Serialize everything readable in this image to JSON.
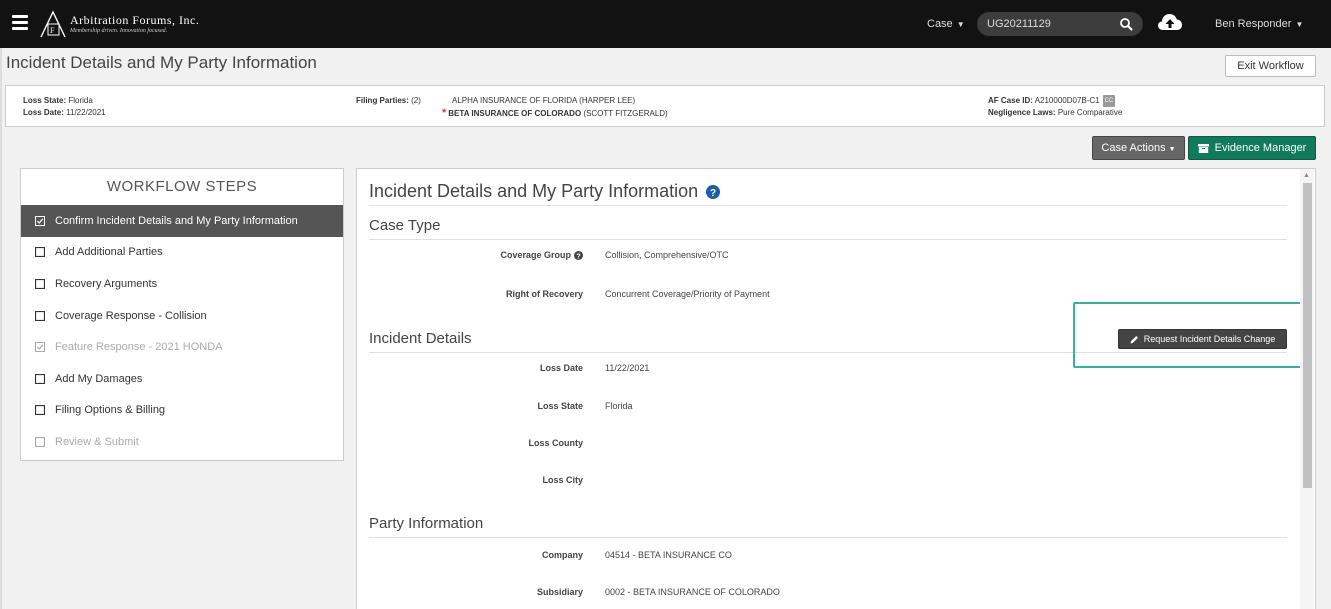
{
  "app": {
    "logo_name": "Arbitration Forums, Inc.",
    "logo_tagline": "Membership driven. Innovation focused.",
    "case_dropdown_label": "Case",
    "search_value": "UG20211129",
    "user_name": "Ben Responder"
  },
  "page": {
    "title": "Incident Details and My Party Information",
    "exit_label": "Exit Workflow"
  },
  "info_bar": {
    "loss_state_label": "Loss State:",
    "loss_state_value": "Florida",
    "loss_date_label": "Loss Date:",
    "loss_date_value": "11/22/2021",
    "filing_parties_label": "Filing Parties:",
    "filing_parties_count": "(2)",
    "parties": [
      {
        "name": "ALPHA INSURANCE OF FLORIDA",
        "contact": "(HARPER LEE)"
      },
      {
        "name": "BETA INSURANCE OF COLORADO",
        "contact": "(SCOTT FITZGERALD)",
        "marker": "*"
      }
    ],
    "case_id_label": "AF Case ID:",
    "case_id_value": "A210000D07B-C1",
    "cc_badge": "CC",
    "negligence_label": "Negligence Laws:",
    "negligence_value": "Pure Comparative"
  },
  "actions": {
    "case_actions_label": "Case Actions",
    "evidence_label": "Evidence Manager"
  },
  "workflow": {
    "title": "WORKFLOW STEPS",
    "steps": [
      {
        "label": "Confirm Incident Details and My Party Information",
        "state": "active"
      },
      {
        "label": "Add Additional Parties",
        "state": "normal"
      },
      {
        "label": "Recovery Arguments",
        "state": "normal"
      },
      {
        "label": "Coverage Response - Collision",
        "state": "normal"
      },
      {
        "label": "Feature Response - 2021 HONDA",
        "state": "disabled"
      },
      {
        "label": "Add My Damages",
        "state": "normal"
      },
      {
        "label": "Filing Options & Billing",
        "state": "normal"
      },
      {
        "label": "Review & Submit",
        "state": "disabled"
      }
    ]
  },
  "main": {
    "heading": "Incident Details and My Party Information",
    "case_type": {
      "heading": "Case Type",
      "coverage_group_label": "Coverage Group",
      "coverage_group_value": "Collision, Comprehensive/OTC",
      "right_of_recovery_label": "Right of Recovery",
      "right_of_recovery_value": "Concurrent Coverage/Priority of Payment"
    },
    "incident_details": {
      "heading": "Incident Details",
      "request_change_label": "Request Incident Details Change",
      "loss_date_label": "Loss Date",
      "loss_date_value": "11/22/2021",
      "loss_state_label": "Loss State",
      "loss_state_value": "Florida",
      "loss_county_label": "Loss County",
      "loss_county_value": "",
      "loss_city_label": "Loss City",
      "loss_city_value": ""
    },
    "party_information": {
      "heading": "Party Information",
      "company_label": "Company",
      "company_value": "04514 - BETA INSURANCE CO",
      "subsidiary_label": "Subsidiary",
      "subsidiary_value": "0002 - BETA INSURANCE OF COLORADO"
    }
  },
  "colors": {
    "topbar": "#121212",
    "evidence_button": "#117a5a",
    "highlight": "#3ab19b",
    "required_marker": "#e53935"
  }
}
